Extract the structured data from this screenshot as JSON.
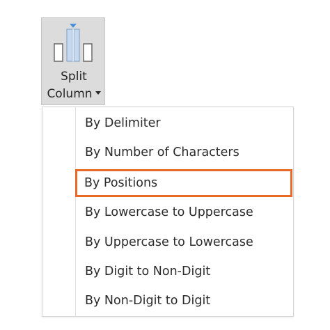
{
  "split_button": {
    "line1": "Split",
    "line2": "Column",
    "icon": "split-column-icon",
    "accent_color": "#4a90d9"
  },
  "menu": {
    "items": [
      {
        "label": "By Delimiter"
      },
      {
        "label": "By Number of Characters"
      },
      {
        "label": "By Positions",
        "highlighted": true
      },
      {
        "label": "By Lowercase to Uppercase"
      },
      {
        "label": "By Uppercase to Lowercase"
      },
      {
        "label": "By Digit to Non-Digit"
      },
      {
        "label": "By Non-Digit to Digit"
      }
    ],
    "highlight_color": "#e8692a"
  }
}
